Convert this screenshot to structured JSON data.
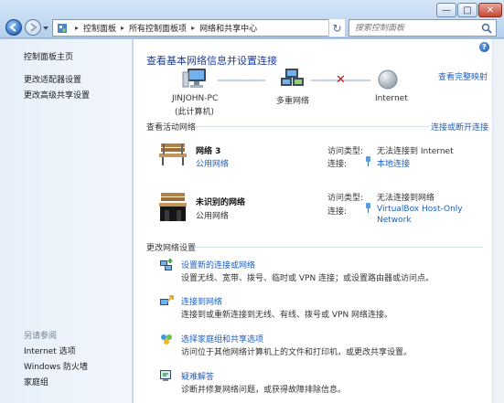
{
  "window": {
    "address": {
      "crumbs": [
        "控制面板",
        "所有控制面板项",
        "网络和共享中心"
      ]
    },
    "search_placeholder": "搜索控制面板",
    "controls": {
      "minimize": "—",
      "maximize": "□",
      "close": "✕"
    }
  },
  "sidebar": {
    "items": [
      "控制面板主页",
      "更改适配器设置",
      "更改高级共享设置"
    ],
    "see_also_title": "另请参阅",
    "see_also": [
      "Internet 选项",
      "Windows 防火墙",
      "家庭组"
    ]
  },
  "main": {
    "title": "查看基本网络信息并设置连接",
    "full_map_link": "查看完整映射",
    "network_map": {
      "computer_name": "JINJOHN-PC",
      "computer_sub": "(此计算机)",
      "multi_network": "多重网络",
      "internet": "Internet"
    },
    "active_networks_title": "查看活动网络",
    "connect_disconnect_link": "连接或断开连接",
    "networks": [
      {
        "name": "网络  3",
        "type": "公用网络",
        "access_label": "访问类型:",
        "access_value": "无法连接到 Internet",
        "conn_label": "连接:",
        "conn_value": "本地连接"
      },
      {
        "name": "未识别的网络",
        "type": "公用网络",
        "access_label": "访问类型:",
        "access_value": "无法连接到网络",
        "conn_label": "连接:",
        "conn_value_line1": "VirtualBox Host-Only",
        "conn_value_line2": "Network"
      }
    ],
    "change_settings_title": "更改网络设置",
    "tasks": [
      {
        "title": "设置新的连接或网络",
        "desc": "设置无线、宽带、拨号、临时或 VPN 连接；或设置路由器或访问点。"
      },
      {
        "title": "连接到网络",
        "desc": "连接到或重新连接到无线、有线、拨号或 VPN 网络连接。"
      },
      {
        "title": "选择家庭组和共享选项",
        "desc": "访问位于其他网络计算机上的文件和打印机，或更改共享设置。"
      },
      {
        "title": "疑难解答",
        "desc": "诊断并修复网络问题，或获得故障排除信息。"
      }
    ]
  }
}
